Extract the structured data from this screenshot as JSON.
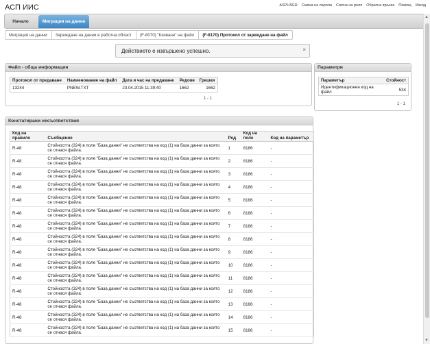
{
  "app": {
    "title": "АСП ИИС"
  },
  "toplinks": [
    "ASPUSER",
    "Смяна на парола",
    "Смяна на роля",
    "Обратна връзка",
    "Помощ",
    "Изход"
  ],
  "nav": {
    "home": "Начало",
    "active": "Миграция на данни"
  },
  "breadcrumbs": [
    "Миграция на данни",
    "Зареждане на данни в работна област",
    "(F-8070) \"Качване\" на файл",
    "(F-8170) Протокол от зареждане на файл"
  ],
  "notice": {
    "text": "Действието е извършено успешно.",
    "close": "×"
  },
  "file_panel": {
    "title": "Файл - обща информация",
    "headers": [
      "Протокол от предаване",
      "Наименование на файл",
      "Дата и час на предаване",
      "Редове",
      "Грешки"
    ],
    "row": [
      "13244",
      "PNEW.TXT",
      "23.04.2015 11:39:40",
      "1662",
      "1662"
    ],
    "pager": "1 - 1"
  },
  "param_panel": {
    "title": "Параметри",
    "headers": [
      "Параметър",
      "Стойност"
    ],
    "row": [
      "Идентификационен код на файл",
      "534"
    ],
    "pager": "1 - 1"
  },
  "mismatch_panel": {
    "title": "Констатирани несъответствия",
    "headers": [
      "Код на правило",
      "Съобщение",
      "Ред",
      "Код на поле",
      "Код на параметър"
    ],
    "rows": [
      [
        "R-48",
        "Стойността (324) в поле \"База данни\" не съответства на код (1) на база данни за която се отнася файла.",
        "1",
        "8186",
        "-"
      ],
      [
        "R-48",
        "Стойността (324) в поле \"База данни\" не съответства на код (1) на база данни за която се отнася файла.",
        "2",
        "8186",
        "-"
      ],
      [
        "R-48",
        "Стойността (324) в поле \"База данни\" не съответства на код (1) на база данни за която се отнася файла.",
        "3",
        "8186",
        "-"
      ],
      [
        "R-48",
        "Стойността (324) в поле \"База данни\" не съответства на код (1) на база данни за която се отнася файла.",
        "4",
        "8186",
        "-"
      ],
      [
        "R-48",
        "Стойността (324) в поле \"База данни\" не съответства на код (1) на база данни за която се отнася файла.",
        "5",
        "8186",
        "-"
      ],
      [
        "R-48",
        "Стойността (324) в поле \"База данни\" не съответства на код (1) на база данни за която се отнася файла.",
        "6",
        "8186",
        "-"
      ],
      [
        "R-48",
        "Стойността (324) в поле \"База данни\" не съответства на код (1) на база данни за която се отнася файла.",
        "7",
        "8186",
        "-"
      ],
      [
        "R-48",
        "Стойността (324) в поле \"База данни\" не съответства на код (1) на база данни за която се отнася файла.",
        "8",
        "8186",
        "-"
      ],
      [
        "R-48",
        "Стойността (324) в поле \"База данни\" не съответства на код (1) на база данни за която се отнася файла.",
        "9",
        "8186",
        "-"
      ],
      [
        "R-48",
        "Стойността (324) в поле \"База данни\" не съответства на код (1) на база данни за която се отнася файла.",
        "10",
        "8186",
        "-"
      ],
      [
        "R-48",
        "Стойността (324) в поле \"База данни\" не съответства на код (1) на база данни за която се отнася файла.",
        "11",
        "8186",
        "-"
      ],
      [
        "R-48",
        "Стойността (324) в поле \"База данни\" не съответства на код (1) на база данни за която се отнася файла.",
        "12",
        "8186",
        "-"
      ],
      [
        "R-48",
        "Стойността (324) в поле \"База данни\" не съответства на код (1) на база данни за която се отнася файла.",
        "13",
        "8186",
        "-"
      ],
      [
        "R-48",
        "Стойността (324) в поле \"База данни\" не съответства на код (1) на база данни за която се отнася файла.",
        "14",
        "8186",
        "-"
      ],
      [
        "R-48",
        "Стойността (324) в поле \"База данни\" не съответства на код (1) на база данни за която се отнася файла.",
        "15",
        "8186",
        "-"
      ]
    ]
  }
}
